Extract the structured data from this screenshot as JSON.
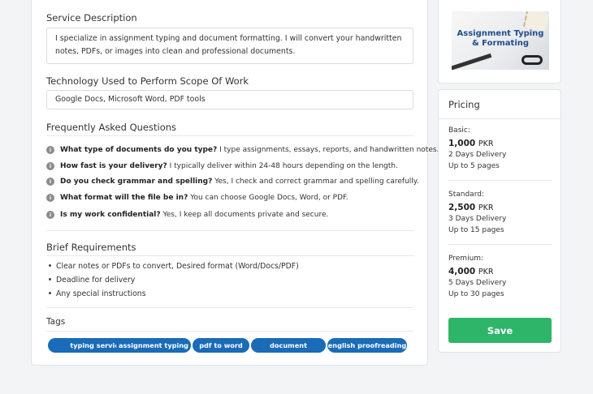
{
  "service_description": {
    "heading": "Service Description",
    "text": "I specialize in assignment typing and document formatting. I will convert your handwritten notes, PDFs, or images into clean and professional documents."
  },
  "technology": {
    "heading": "Technology Used to Perform Scope Of Work",
    "value": "Google Docs, Microsoft Word, PDF tools"
  },
  "faq": {
    "heading": "Frequently Asked Questions",
    "items": [
      {
        "q": "What type of documents do you type?",
        "a": "I type assignments, essays, reports, and handwritten notes."
      },
      {
        "q": "How fast is your delivery?",
        "a": "I typically deliver within 24-48 hours depending on the length."
      },
      {
        "q": "Do you check grammar and spelling?",
        "a": "Yes, I check and correct grammar and spelling carefully."
      },
      {
        "q": "What format will the file be in?",
        "a": "You can choose Google Docs, Word, or PDF."
      },
      {
        "q": "Is my work confidential?",
        "a": "Yes, I keep all documents private and secure."
      }
    ]
  },
  "requirements": {
    "heading": "Brief Requirements",
    "items": [
      "Clear notes or PDFs to convert, Desired format (Word/Docs/PDF)",
      "Deadline for delivery",
      "Any special instructions"
    ]
  },
  "tags": {
    "heading": "Tags",
    "items": [
      "typing service",
      "assignment typing",
      "pdf to word",
      "document formatting",
      "english proofreading"
    ]
  },
  "thumbnail": {
    "title_line1": "Assignment Typing",
    "title_line2": "& Formating"
  },
  "pricing": {
    "heading": "Pricing",
    "tiers": [
      {
        "name": "Basic:",
        "price": "1,000",
        "currency": "PKR",
        "delivery": "2 Days Delivery",
        "pages": "Up to 5 pages"
      },
      {
        "name": "Standard:",
        "price": "2,500",
        "currency": "PKR",
        "delivery": "3 Days Delivery",
        "pages": "Up to 15 pages"
      },
      {
        "name": "Premium:",
        "price": "4,000",
        "currency": "PKR",
        "delivery": "5 Days Delivery",
        "pages": "Up to 30 pages"
      }
    ],
    "save_label": "Save"
  },
  "colors": {
    "tag_bg": "#1a6bb8",
    "save_bg": "#2eb56a",
    "faq_icon": "#8c8c8c"
  },
  "icons": {
    "faq_marker": "info-circle-icon"
  }
}
